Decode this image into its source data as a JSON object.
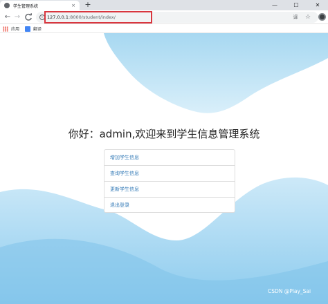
{
  "tab": {
    "title": "学生管理系统",
    "close": "×"
  },
  "new_tab": "+",
  "window_controls": {
    "minimize": "—",
    "maximize": "☐",
    "close": "✕"
  },
  "nav": {
    "back": "←",
    "forward": "→",
    "reload": "C"
  },
  "address": {
    "host": "127.0.0.1",
    "rest": ":8000/student/index/",
    "info_glyph": "i"
  },
  "omnibox_icons": {
    "translate": "译",
    "star": "☆"
  },
  "bookmarks": {
    "apps": "应用",
    "fanyi": "翻译"
  },
  "page": {
    "welcome": "你好：admin,欢迎来到学生信息管理系统",
    "menu": [
      "增加学生信息",
      "查询学生信息",
      "更新学生信息",
      "退出登录"
    ]
  },
  "watermark": "CSDN @Play_Sai",
  "colors": {
    "highlight_border": "#d9363e",
    "link": "#337ab7",
    "wave_light": "#d4ecf8",
    "wave_dark": "#88c8ec"
  }
}
